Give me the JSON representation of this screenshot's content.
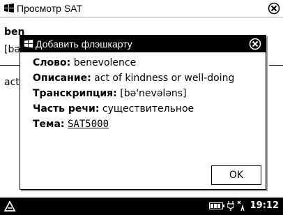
{
  "window": {
    "title": "Просмотр SAT"
  },
  "background": {
    "word_partial": "ben",
    "transcription_partial": "[bə'",
    "text_partial": "act"
  },
  "dialog": {
    "title": "Добавить флэшкарту",
    "fields": [
      {
        "label": "Слово:",
        "value": "benevolence"
      },
      {
        "label": "Описание:",
        "value": "act of kindness or well-doing"
      },
      {
        "label": "Транскрипция:",
        "value": "[bə'nevələns]"
      },
      {
        "label": "Часть речи:",
        "value": "существительное"
      },
      {
        "label": "Тема:",
        "value": "SAT5000"
      }
    ],
    "ok_label": "OK"
  },
  "taskbar": {
    "time": "19:12"
  },
  "icons": {
    "title_logo": "windows-flag-icon",
    "close": "close-circle-icon",
    "start": "start-menu-icon",
    "battery": "battery-icon",
    "plug": "power-plug-icon",
    "signal": "signal-icon"
  }
}
